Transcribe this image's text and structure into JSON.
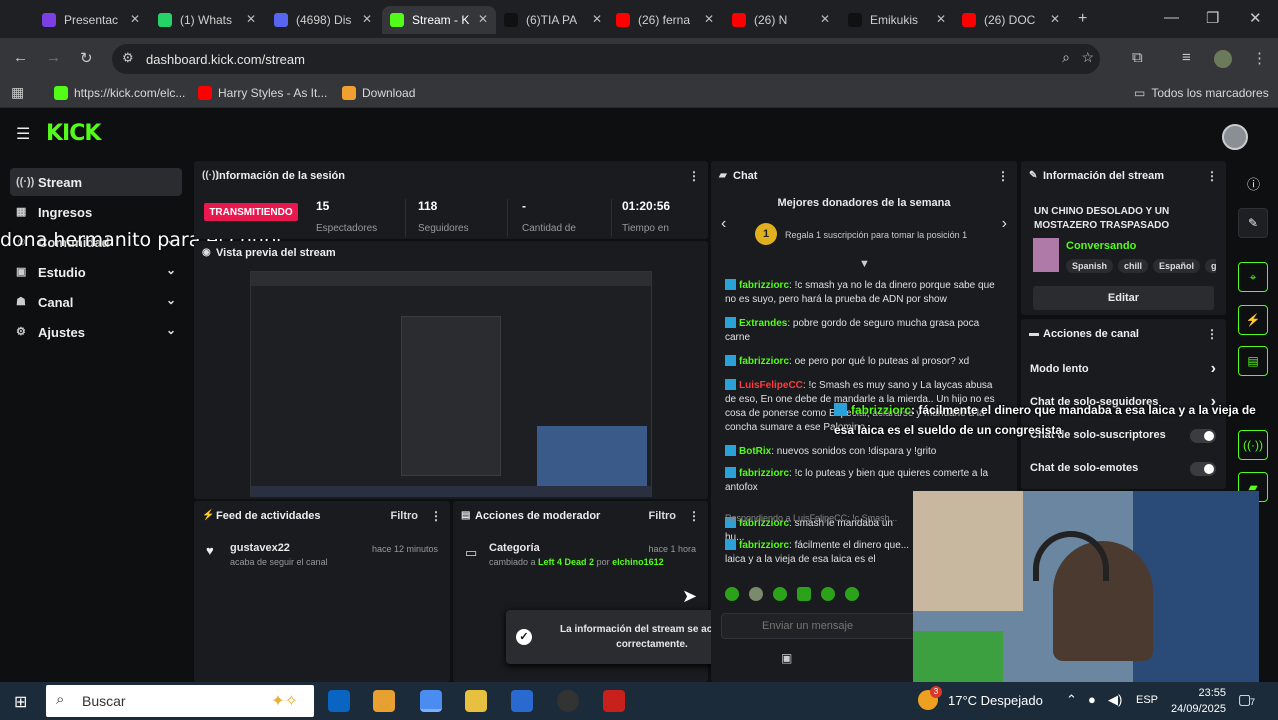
{
  "browser": {
    "tabs": [
      {
        "label": "Presentac",
        "fav_color": "#7b3fe4"
      },
      {
        "label": "(1) Whats",
        "fav_color": "#25d366"
      },
      {
        "label": "(4698) Dis",
        "fav_color": "#5865f2"
      },
      {
        "label": "Stream - K",
        "fav_color": "#53fc18"
      },
      {
        "label": "(6)TIA PA",
        "fav_color": "#111111"
      },
      {
        "label": "(26) ferna",
        "fav_color": "#ff0000"
      },
      {
        "label": "(26) N",
        "fav_color": "#ff0000"
      },
      {
        "label": "Emikukis",
        "fav_color": "#111111"
      },
      {
        "label": "(26) DOC",
        "fav_color": "#ff0000"
      }
    ],
    "url": "dashboard.kick.com/stream",
    "bookmarks": [
      {
        "label": "https://kick.com/elc...",
        "color": "#53fc18"
      },
      {
        "label": "Harry Styles - As It...",
        "color": "#ff0000"
      },
      {
        "label": "Download",
        "color": "#f0a030"
      }
    ],
    "all_bookmarks": "Todos los marcadores"
  },
  "app": {
    "logo": "KICK",
    "sidebar": [
      {
        "label": "Stream",
        "icon": "stream-icon",
        "glyph": "((·))",
        "active": true,
        "chevron": false
      },
      {
        "label": "Ingresos",
        "icon": "income-icon",
        "glyph": "▦",
        "active": false,
        "chevron": false
      },
      {
        "label": "Comunidad",
        "icon": "community-icon",
        "glyph": "☺",
        "active": false,
        "chevron": true
      },
      {
        "label": "Estudio",
        "icon": "studio-icon",
        "glyph": "▣",
        "active": false,
        "chevron": true
      },
      {
        "label": "Canal",
        "icon": "channel-icon",
        "glyph": "☗",
        "active": false,
        "chevron": true
      },
      {
        "label": "Ajustes",
        "icon": "gear-icon",
        "glyph": "⚙",
        "active": false,
        "chevron": true
      }
    ],
    "overlay_caption": "dona hermanito para el chupi",
    "session": {
      "title": "Información de la sesión",
      "live_badge": "TRANSMITIENDO",
      "stats": [
        {
          "value": "15",
          "label": "Espectadores"
        },
        {
          "value": "118",
          "label": "Seguidores"
        },
        {
          "value": "-",
          "label": "Cantidad de"
        },
        {
          "value": "01:20:56",
          "label": "Tiempo en"
        }
      ]
    },
    "preview": {
      "title": "Vista previa del stream"
    },
    "activity": {
      "title": "Feed de actividades",
      "filter": "Filtro",
      "items": [
        {
          "user": "gustavex22",
          "time": "hace 12 minutos",
          "text": "acaba de seguir el canal"
        }
      ]
    },
    "modactions": {
      "title": "Acciones de moderador",
      "filter": "Filtro",
      "items": [
        {
          "title": "Categoría",
          "time": "hace 1 hora",
          "prefix": "cambiado a",
          "game": "Left 4 Dead 2",
          "by": "por",
          "mod": "elchino1612"
        }
      ]
    },
    "toast": "La información del stream se actualizó correctamente.",
    "chat": {
      "title": "Chat",
      "donors_title": "Mejores donadores de la semana",
      "donor_slot": "1",
      "donor_prompt": "Regala 1 suscripción para tomar la posición 1",
      "messages": [
        {
          "user": "fabrizziorc",
          "color": "#53fc18",
          "text": "!c smash ya no le da dinero porque sabe que no es suyo, pero hará la prueba de ADN por show"
        },
        {
          "user": "Extrandes",
          "color": "#53fc18",
          "text": "pobre gordo de seguro mucha grasa poca carne"
        },
        {
          "user": "fabrizziorc",
          "color": "#53fc18",
          "text": "oe pero por qué lo puteas al prosor? xd"
        },
        {
          "user": "LuisFelipeCC",
          "color": "#ff3b3b",
          "text": "!c Smash es muy sano y La laycas abusa de eso, En one debe de mandarle a la mierda.. Un hijo no es cosa de ponerse como Especial, aclararse y mandarle a la concha sumare a ese Palomino"
        },
        {
          "user": "BotRix",
          "color": "#53fc18",
          "text": "nuevos sonidos con !dispara y !grito"
        },
        {
          "user": "fabrizziorc",
          "color": "#53fc18",
          "text": "!c lo puteas y bien que quieres comerte a la antofox"
        },
        {
          "user": "fabrizziorc",
          "color": "#53fc18",
          "text": "smash le mandaba un hu..."
        },
        {
          "user": "fabrizziorc",
          "color": "#53fc18",
          "text": "fácilmente el dinero que... laica y a la vieja de esa laica es el sueldo..."
        }
      ],
      "reply_hint": "Respondiendo a LuisFelipeCC: !c Smash...",
      "input_placeholder": "Enviar un mensaje"
    },
    "floating_chat": {
      "user": "fabrizziorc",
      "text": ": fácilmente el dinero que mandaba a esa laica y a la vieja de esa laica es el sueldo de un congresista"
    },
    "stream_info": {
      "title": "Información del stream",
      "stream_title": "UN CHINO DESOLADO Y UN MOSTAZERO TRASPASADO",
      "category": "Conversando",
      "tags": [
        "Spanish",
        "chill",
        "Español",
        "g"
      ],
      "edit_label": "Editar"
    },
    "channel_actions": {
      "title": "Acciones de canal",
      "items": [
        {
          "label": "Modo lento",
          "type": "chevron"
        },
        {
          "label": "Chat de solo-seguidores",
          "type": "chevron"
        },
        {
          "label": "Chat de solo-suscriptores",
          "type": "toggle"
        },
        {
          "label": "Chat de solo-emotes",
          "type": "toggle"
        }
      ]
    }
  },
  "taskbar": {
    "search_placeholder": "Buscar",
    "weather": "17°C  Despejado",
    "lang": "ESP",
    "time": "23:55",
    "date": "24/09/2025",
    "notif_count": "7",
    "weather_badge": "3"
  }
}
